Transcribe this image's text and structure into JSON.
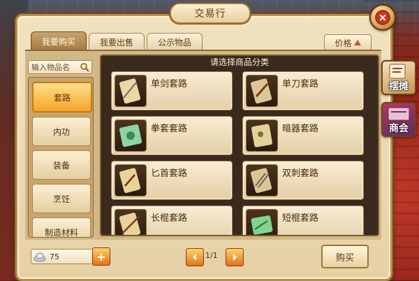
{
  "window": {
    "title": "交易行"
  },
  "tabs": [
    {
      "label": "我要购买"
    },
    {
      "label": "我要出售"
    },
    {
      "label": "公示物品"
    }
  ],
  "sort": {
    "label": "价格"
  },
  "search": {
    "placeholder": "输入物品名"
  },
  "categories": [
    {
      "label": "套路"
    },
    {
      "label": "内功"
    },
    {
      "label": "装备"
    },
    {
      "label": "烹饪"
    },
    {
      "label": "制造材料"
    }
  ],
  "panel": {
    "title": "请选择商品分类",
    "items": [
      {
        "label": "单剑套路"
      },
      {
        "label": "单刀套路"
      },
      {
        "label": "拳套套路"
      },
      {
        "label": "暗器套路"
      },
      {
        "label": "匕首套路"
      },
      {
        "label": "双刺套路"
      },
      {
        "label": "长棍套路"
      },
      {
        "label": "短棍套路"
      }
    ]
  },
  "side": [
    {
      "label": "摆摊"
    },
    {
      "label": "商会"
    }
  ],
  "footer": {
    "coins": "75",
    "page": "1/1",
    "buy_label": "购买"
  }
}
